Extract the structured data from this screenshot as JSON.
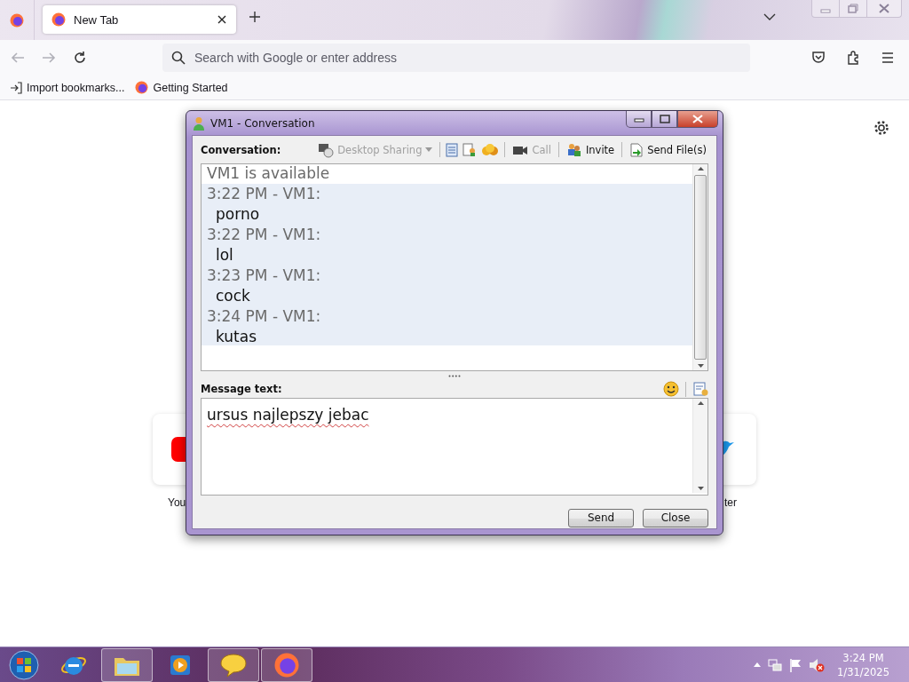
{
  "browser": {
    "tabs": [
      {
        "label": "New Tab",
        "selected": true
      }
    ],
    "address_bar": {
      "placeholder": "Search with Google or enter address"
    },
    "bookmarks": [
      "Import bookmarks...",
      "Getting Started"
    ],
    "shortcuts": [
      {
        "kind": "video",
        "label": "You"
      },
      {
        "kind": "bird",
        "label": "ter"
      }
    ]
  },
  "conversation_window": {
    "title": "VM1 - Conversation",
    "conversation_label": "Conversation:",
    "toolbar": [
      {
        "kind": "sharing",
        "label": "Desktop Sharing",
        "disabled": true
      },
      {
        "kind": "notes"
      },
      {
        "kind": "info"
      },
      {
        "kind": "emotes"
      },
      {
        "kind": "call",
        "label": "Call",
        "disabled": true
      },
      {
        "kind": "invite",
        "label": "Invite",
        "disabled": false
      },
      {
        "kind": "file",
        "label": "Send File(s)",
        "disabled": false
      }
    ],
    "status": "VM1 is available",
    "messages": [
      {
        "header": "3:22 PM - VM1:",
        "text": "porno"
      },
      {
        "header": "3:22 PM - VM1:",
        "text": "lol"
      },
      {
        "header": "3:23 PM - VM1:",
        "text": "cock"
      },
      {
        "header": "3:24 PM - VM1:",
        "text": "kutas"
      }
    ],
    "message_label": "Message text:",
    "message_value": "ursus najlepszy jebac",
    "buttons": [
      "Send",
      "Close"
    ]
  },
  "taskbar": {
    "apps": [
      {
        "kind": "ie",
        "running": false
      },
      {
        "kind": "explorer",
        "running": true
      },
      {
        "kind": "media",
        "running": false
      },
      {
        "kind": "chat",
        "running": true
      },
      {
        "kind": "firefox",
        "running": true
      }
    ],
    "clock": {
      "time": "3:24 PM",
      "date": "1/31/2025"
    }
  }
}
